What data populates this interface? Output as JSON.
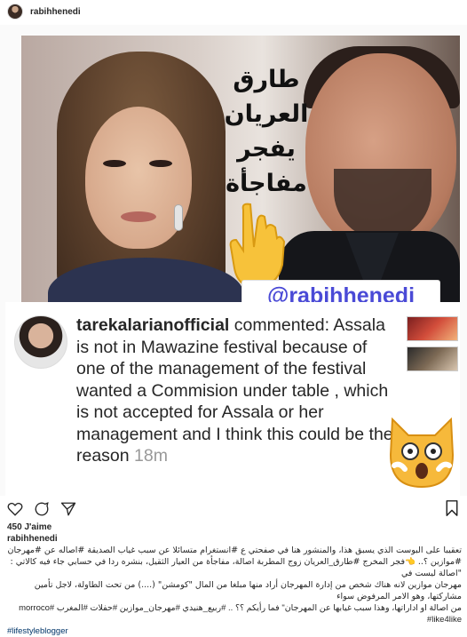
{
  "header": {
    "username": "rabihhenedi"
  },
  "post": {
    "arabic_headline": [
      "طارق",
      "العريان",
      "يفجر",
      "مفاجأة"
    ],
    "watermark_handle": "@rabihhenedi",
    "emoji_hand": "pointing-down-hand",
    "emoji_cat": "shocked-cat",
    "comment": {
      "user": "tarekalarianofficial",
      "verb": "commented:",
      "text": "Assala is not in Mawazine festival because of one of  the management of the festival wanted a Commision under table , which is not accepted for Assala or her management and I think this could be the reason",
      "time": "18m"
    }
  },
  "actions": {
    "icons": [
      "heart-icon",
      "comment-icon",
      "share-icon",
      "bookmark-icon"
    ]
  },
  "likes_text": "450 J'aime",
  "caption": {
    "username": "rabihhenedi",
    "line1": "تعقيبا على البوست الذي يسبق هذا، والمنشور هنا في صفحتي ع #انستغرام متسائلا عن سبب غياب الصديقة #اصاله عن #مهرجان",
    "line2": "#موازين ؟.. 👈فجر المخرج #طارق_العريان زوج المطربة اصالة، مفاجأة من العيار الثقيل، بنشره ردا في حسابي جاء فيه كالاتي : \"اصالة ليست في",
    "line3": "مهرجان موازين لانه هناك شخص من إدارة المهرجان أراد منها مبلغا من المال \"كومشن\" (....) من تحت الطاولة، لاجل تأمين مشاركتها، وهو الامر المرفوض سواء",
    "line4": "من اصالة او اداراتها، وهذا سبب غيابها عن المهرجان\" فما رأيكم ؟؟ .. #ربيع_هنيدي #مهرجان_موازين #حفلات #المغرب #morroco #like4like",
    "line5": "#lifestyleblogger"
  }
}
